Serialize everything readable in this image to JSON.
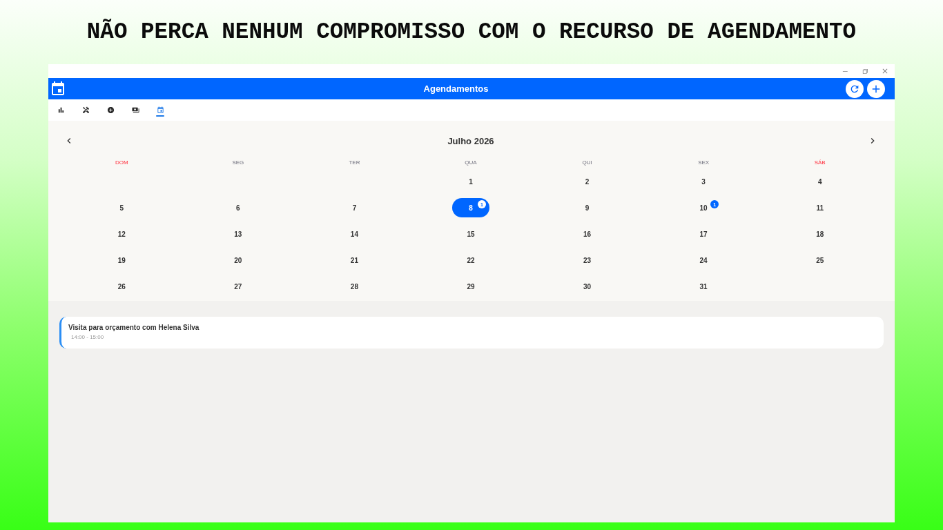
{
  "headline": "NÃO PERCA NENHUM COMPROMISSO COM O RECURSO DE AGENDAMENTO",
  "app_bar": {
    "title": "Agendamentos"
  },
  "tabs": [
    {
      "kind": "chart",
      "selected": false
    },
    {
      "kind": "tools",
      "selected": false
    },
    {
      "kind": "add",
      "selected": false
    },
    {
      "kind": "money",
      "selected": false
    },
    {
      "kind": "calendar",
      "selected": true
    }
  ],
  "calendar": {
    "month": "Julho 2026",
    "weekdays": [
      {
        "label": "DOM",
        "weekend": true
      },
      {
        "label": "SEG",
        "weekend": false
      },
      {
        "label": "TER",
        "weekend": false
      },
      {
        "label": "QUA",
        "weekend": false
      },
      {
        "label": "QUI",
        "weekend": false
      },
      {
        "label": "SEX",
        "weekend": false
      },
      {
        "label": "SÁB",
        "weekend": true
      }
    ],
    "weeks": [
      [
        {
          "kind": "blank"
        },
        {
          "kind": "blank"
        },
        {
          "kind": "blank"
        },
        {
          "kind": "day",
          "label": "1",
          "selected": false
        },
        {
          "kind": "day",
          "label": "2",
          "selected": false
        },
        {
          "kind": "day",
          "label": "3",
          "selected": false
        },
        {
          "kind": "day",
          "label": "4",
          "selected": false
        }
      ],
      [
        {
          "kind": "day",
          "label": "5",
          "selected": false
        },
        {
          "kind": "day",
          "label": "6",
          "selected": false
        },
        {
          "kind": "day",
          "label": "7",
          "selected": false
        },
        {
          "kind": "day",
          "label": "8",
          "selected": true,
          "badge": "1"
        },
        {
          "kind": "day",
          "label": "9",
          "selected": false
        },
        {
          "kind": "day",
          "label": "10",
          "selected": false,
          "badge": "1"
        },
        {
          "kind": "day",
          "label": "11",
          "selected": false
        }
      ],
      [
        {
          "kind": "day",
          "label": "12",
          "selected": false
        },
        {
          "kind": "day",
          "label": "13",
          "selected": false
        },
        {
          "kind": "day",
          "label": "14",
          "selected": false
        },
        {
          "kind": "day",
          "label": "15",
          "selected": false
        },
        {
          "kind": "day",
          "label": "16",
          "selected": false
        },
        {
          "kind": "day",
          "label": "17",
          "selected": false
        },
        {
          "kind": "day",
          "label": "18",
          "selected": false
        }
      ],
      [
        {
          "kind": "day",
          "label": "19",
          "selected": false
        },
        {
          "kind": "day",
          "label": "20",
          "selected": false
        },
        {
          "kind": "day",
          "label": "21",
          "selected": false
        },
        {
          "kind": "day",
          "label": "22",
          "selected": false
        },
        {
          "kind": "day",
          "label": "23",
          "selected": false
        },
        {
          "kind": "day",
          "label": "24",
          "selected": false
        },
        {
          "kind": "day",
          "label": "25",
          "selected": false
        }
      ],
      [
        {
          "kind": "day",
          "label": "26",
          "selected": false
        },
        {
          "kind": "day",
          "label": "27",
          "selected": false
        },
        {
          "kind": "day",
          "label": "28",
          "selected": false
        },
        {
          "kind": "day",
          "label": "29",
          "selected": false
        },
        {
          "kind": "day",
          "label": "30",
          "selected": false
        },
        {
          "kind": "day",
          "label": "31",
          "selected": false
        }
      ]
    ]
  },
  "events": [
    {
      "title": "Visita para orçamento com Helena Silva",
      "time": "14:00 - 15:00"
    }
  ]
}
